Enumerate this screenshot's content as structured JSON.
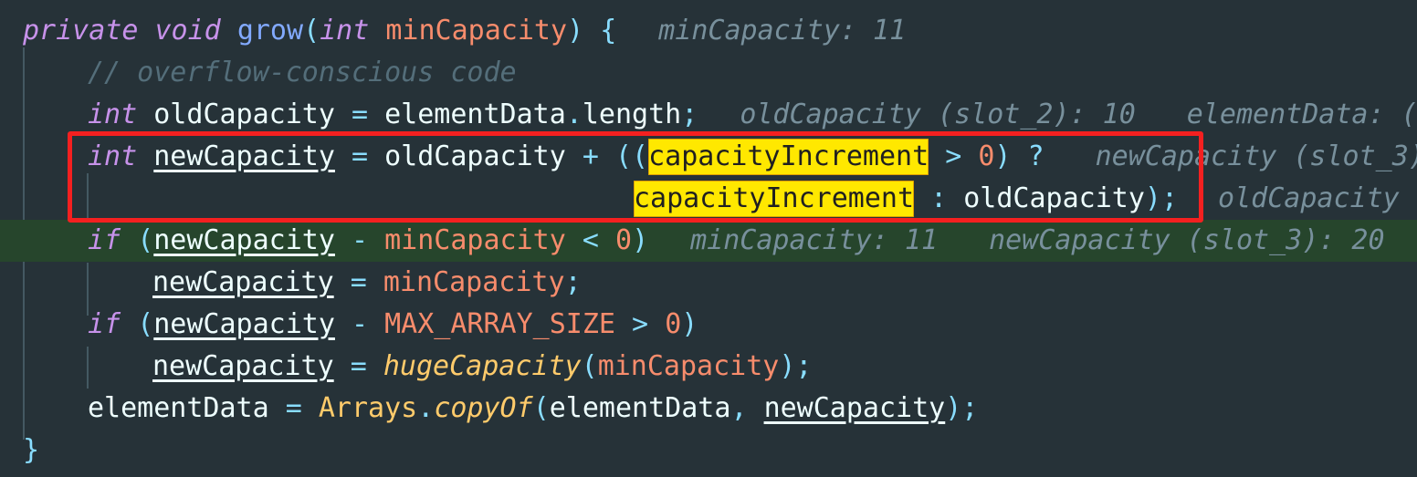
{
  "editor": {
    "background": "#263238",
    "font_size_px": 30,
    "line_height_px": 46,
    "language": "java",
    "execution_highlight_color": "#26452c",
    "annotation_box_color": "#f42020",
    "occurrence_highlight_color": "#ffe800"
  },
  "code": {
    "l1": {
      "kw_private": "private",
      "sp1": " ",
      "kw_void": "void",
      "sp2": " ",
      "name": "grow",
      "paren_open": "(",
      "kw_int": "int",
      "sp3": " ",
      "param": "minCapacity",
      "paren_close": ")",
      "sp4": " ",
      "brace": "{",
      "hint": "minCapacity: 11"
    },
    "l2": {
      "comment": "// overflow-conscious code"
    },
    "l3": {
      "kw_int": "int",
      "sp1": " ",
      "var": "oldCapacity",
      "eq": " = ",
      "field": "elementData",
      "dot": ".",
      "len": "length",
      "semi": ";",
      "hint1": "oldCapacity (slot_2): 10",
      "hint2": "elementData: ("
    },
    "l4": {
      "kw_int": "int",
      "sp1": " ",
      "var": "newCapacity",
      "eq": " = ",
      "old": "oldCapacity",
      "plus": " + ",
      "parens": "((",
      "hl": "capacityIncrement",
      "gt": " > ",
      "zero": "0",
      "close": ")",
      "question": " ?",
      "hint": "newCapacity (slot_3)"
    },
    "l5": {
      "hl": "capacityIncrement",
      "colon": " : ",
      "old": "oldCapacity",
      "close": ");",
      "hint": "oldCapacity"
    },
    "l6": {
      "kw_if": "if",
      "sp1": " ",
      "paren_open": "(",
      "var": "newCapacity",
      "minus": " - ",
      "param": "minCapacity",
      "lt": " < ",
      "zero": "0",
      "paren_close": ")",
      "hint1": "minCapacity: 11",
      "hint2": "newCapacity (slot_3): 20"
    },
    "l7": {
      "var": "newCapacity",
      "eq": " = ",
      "param": "minCapacity",
      "semi": ";"
    },
    "l8": {
      "kw_if": "if",
      "sp1": " ",
      "paren_open": "(",
      "var": "newCapacity",
      "minus": " - ",
      "const": "MAX_ARRAY_SIZE",
      "gt": " > ",
      "zero": "0",
      "paren_close": ")"
    },
    "l9": {
      "var": "newCapacity",
      "eq": " = ",
      "method": "hugeCapacity",
      "paren_open": "(",
      "param": "minCapacity",
      "paren_close": ");"
    },
    "l10": {
      "field": "elementData",
      "eq": " = ",
      "cls": "Arrays",
      "dot": ".",
      "method": "copyOf",
      "paren_open": "(",
      "arg1": "elementData",
      "comma": ", ",
      "arg2": "newCapacity",
      "paren_close": ");"
    },
    "l11": {
      "brace": "}"
    }
  }
}
